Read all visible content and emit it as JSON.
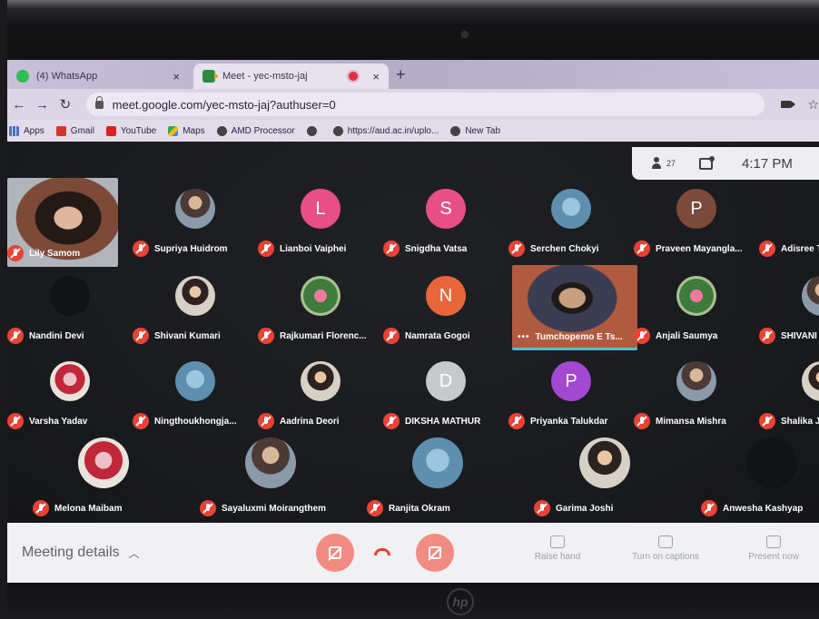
{
  "browser": {
    "tabs": [
      {
        "label": "(4) WhatsApp",
        "icon": "whatsapp-icon"
      },
      {
        "label": "Meet - yec-msto-jaj",
        "icon": "meet-icon"
      }
    ],
    "new_tab": "+",
    "url": "meet.google.com/yec-msto-jaj?authuser=0",
    "bookmarks": [
      "Apps",
      "Gmail",
      "YouTube",
      "Maps",
      "AMD Processor",
      "",
      "https://aud.ac.in/uplo...",
      "New Tab"
    ]
  },
  "meet": {
    "people_count": "27",
    "time": "4:17 PM",
    "participants": [
      {
        "name": "Lily Samom",
        "avatar": "video",
        "row": 0,
        "col": 0
      },
      {
        "name": "Supriya Huidrom",
        "avatar": "photo",
        "row": 0,
        "col": 1
      },
      {
        "name": "Lianboi Vaiphei",
        "avatar": "L",
        "color": "#e84f86",
        "row": 0,
        "col": 2
      },
      {
        "name": "Snigdha Vatsa",
        "avatar": "S",
        "color": "#e84f86",
        "row": 0,
        "col": 3
      },
      {
        "name": "Serchen Chokyi",
        "avatar": "photo4",
        "row": 0,
        "col": 4
      },
      {
        "name": "Praveen Mayangla...",
        "avatar": "P",
        "color": "#7b4a3a",
        "row": 0,
        "col": 5
      },
      {
        "name": "Adisree T",
        "avatar": "partial",
        "row": 0,
        "col": 6
      },
      {
        "name": "Nandini Devi",
        "avatar": "dark",
        "row": 1,
        "col": 0
      },
      {
        "name": "Shivani Kumari",
        "avatar": "photo2",
        "row": 1,
        "col": 1
      },
      {
        "name": "Rajkumari Florenc...",
        "avatar": "photo3",
        "row": 1,
        "col": 2
      },
      {
        "name": "Namrata Gogoi",
        "avatar": "N",
        "color": "#e8663a",
        "row": 1,
        "col": 3
      },
      {
        "name": "Tumchopemo E Ts...",
        "avatar": "video",
        "row": 1,
        "col": 4
      },
      {
        "name": "Anjali Saumya",
        "avatar": "photo3",
        "row": 1,
        "col": 5
      },
      {
        "name": "SHIVANI J",
        "avatar": "photo",
        "row": 1,
        "col": 6
      },
      {
        "name": "Varsha Yadav",
        "avatar": "photo5",
        "row": 2,
        "col": 0
      },
      {
        "name": "Ningthoukhongja...",
        "avatar": "photo4",
        "row": 2,
        "col": 1
      },
      {
        "name": "Aadrina Deori",
        "avatar": "photo2",
        "row": 2,
        "col": 2
      },
      {
        "name": "DIKSHA MATHUR",
        "avatar": "D",
        "color": "#c7c9cc",
        "row": 2,
        "col": 3
      },
      {
        "name": "Priyanka Talukdar",
        "avatar": "P",
        "color": "#a348d0",
        "row": 2,
        "col": 4
      },
      {
        "name": "Mimansa Mishra",
        "avatar": "photo",
        "row": 2,
        "col": 5
      },
      {
        "name": "Shalika Ja",
        "avatar": "photo2",
        "row": 2,
        "col": 6
      },
      {
        "name": "Melona Maibam",
        "avatar": "photo5",
        "row": 3,
        "col": 0
      },
      {
        "name": "Sayaluxmi Moirangthem",
        "avatar": "photo",
        "row": 3,
        "col": 1
      },
      {
        "name": "Ranjita Okram",
        "avatar": "photo4",
        "row": 3,
        "col": 2
      },
      {
        "name": "Garima Joshi",
        "avatar": "photo2",
        "row": 3,
        "col": 3
      },
      {
        "name": "Anwesha Kashyap",
        "avatar": "dark",
        "row": 3,
        "col": 4
      }
    ]
  },
  "controls": {
    "meeting_details": "Meeting details",
    "raise_hand": "Raise hand",
    "captions": "Turn on captions",
    "present": "Present now"
  }
}
